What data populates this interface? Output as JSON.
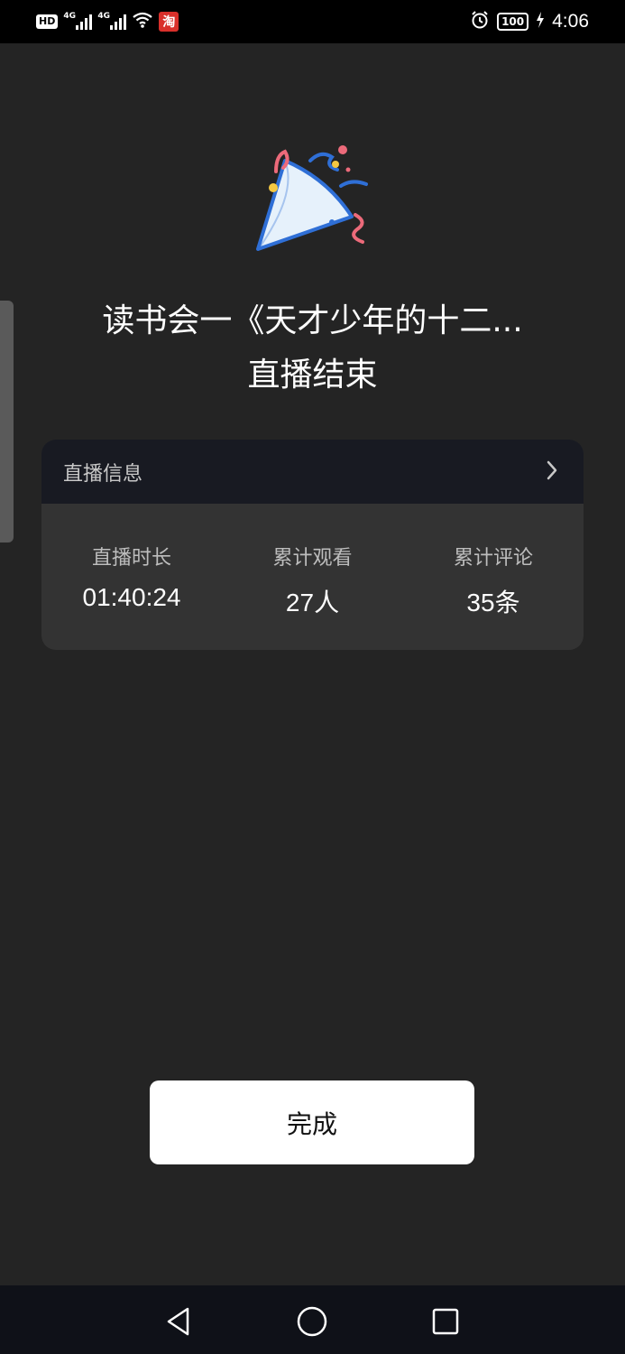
{
  "status_bar": {
    "hd_label": "HD",
    "signal1_label": "4G",
    "signal2_label": "4G",
    "app_badge": "淘",
    "battery": "100",
    "time": "4:06"
  },
  "header": {
    "title_line1": "读书会一《天才少年的十二...",
    "title_line2": "直播结束"
  },
  "info_card": {
    "header_label": "直播信息",
    "stats": [
      {
        "label": "直播时长",
        "value": "01:40:24"
      },
      {
        "label": "累计观看",
        "value": "27人"
      },
      {
        "label": "累计评论",
        "value": "35条"
      }
    ]
  },
  "actions": {
    "done_label": "完成"
  },
  "icons": {
    "hero": "party-popper-icon",
    "header_arrow": "chevron-right-icon",
    "nav_back": "back-triangle-icon",
    "nav_home": "home-circle-icon",
    "nav_recents": "recents-square-icon"
  },
  "colors": {
    "background": "#242424",
    "card": "#333333",
    "card_header": "#181a22",
    "button": "#ffffff"
  }
}
